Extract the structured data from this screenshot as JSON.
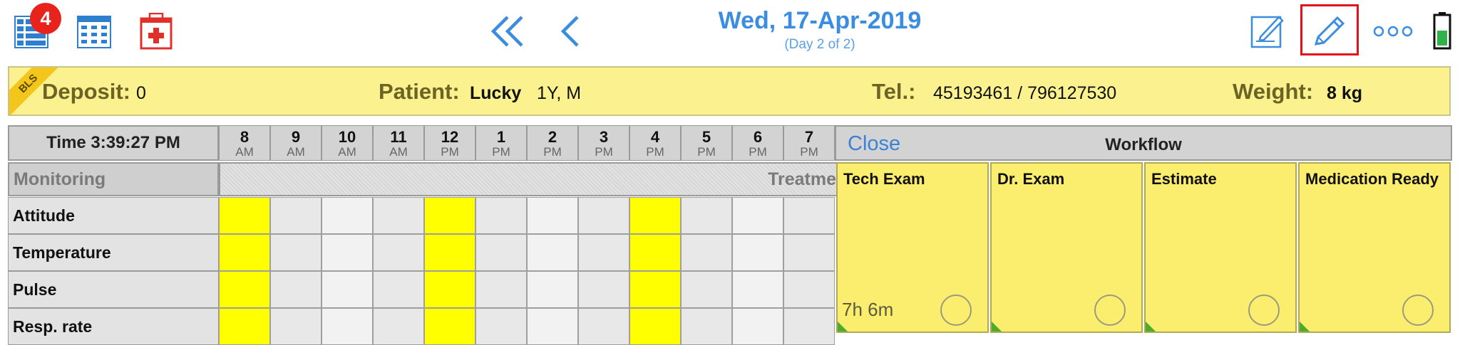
{
  "toolbar": {
    "badge_count": "4",
    "icons": [
      "list-icon",
      "calendar-grid-icon",
      "medical-kit-icon",
      "double-chevron-left-icon",
      "chevron-left-icon",
      "edit-note-icon",
      "pencil-icon",
      "more-icon",
      "battery-icon"
    ],
    "date": "Wed, 17-Apr-2019",
    "day_info": "(Day 2 of 2)",
    "accent": "#3b8de0"
  },
  "banner": {
    "tag": "BLS",
    "deposit_label": "Deposit:",
    "deposit_value": "0",
    "patient_label": "Patient:",
    "patient_name": "Lucky",
    "patient_info": "1Y,  M",
    "tel_label": "Tel.:",
    "tel_value": "45193461 / 796127530",
    "weight_label": "Weight:",
    "weight_value": "8 kg",
    "background": "#fbf28f"
  },
  "grid": {
    "time": "Time 3:39:27 PM",
    "hours": [
      {
        "h": "8",
        "ap": "AM"
      },
      {
        "h": "9",
        "ap": "AM"
      },
      {
        "h": "10",
        "ap": "AM"
      },
      {
        "h": "11",
        "ap": "AM"
      },
      {
        "h": "12",
        "ap": "PM"
      },
      {
        "h": "1",
        "ap": "PM"
      },
      {
        "h": "2",
        "ap": "PM"
      },
      {
        "h": "3",
        "ap": "PM"
      },
      {
        "h": "4",
        "ap": "PM"
      },
      {
        "h": "5",
        "ap": "PM"
      },
      {
        "h": "6",
        "ap": "PM"
      },
      {
        "h": "7",
        "ap": "PM"
      }
    ],
    "section": "Monitoring",
    "section_band_text": "Treatme",
    "rows": [
      "Attitude",
      "Temperature",
      "Pulse",
      "Resp. rate"
    ],
    "highlight_hours": [
      "8",
      "12",
      "4"
    ],
    "highlight_color": "#ffff00"
  },
  "workflow": {
    "close": "Close",
    "title": "Workflow",
    "cards": [
      {
        "title": "Tech Exam",
        "time": "7h 6m"
      },
      {
        "title": "Dr. Exam",
        "time": ""
      },
      {
        "title": "Estimate",
        "time": ""
      },
      {
        "title": "Medication Ready",
        "time": ""
      }
    ]
  }
}
